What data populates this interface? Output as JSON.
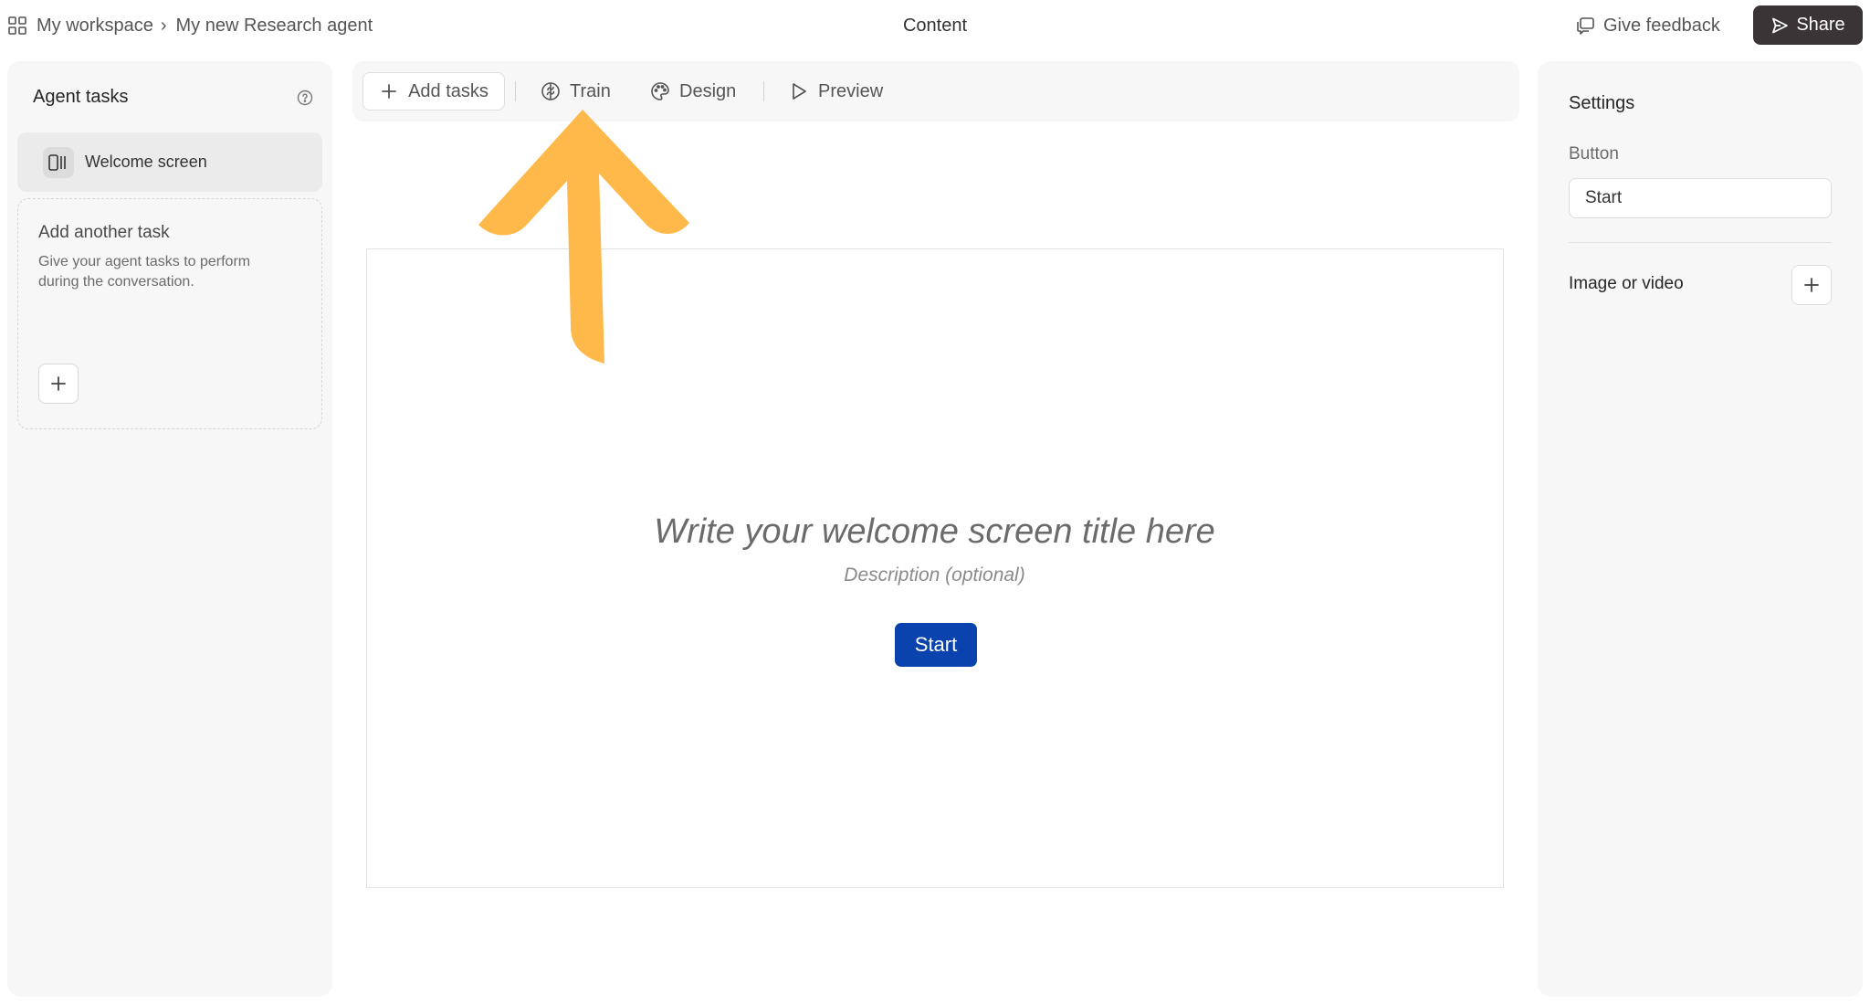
{
  "breadcrumb": {
    "workspace": "My workspace",
    "separator": "›",
    "agent": "My new Research agent"
  },
  "header": {
    "title": "Content",
    "feedback_label": "Give feedback",
    "share_label": "Share"
  },
  "sidebar": {
    "title": "Agent tasks",
    "items": [
      {
        "label": "Welcome screen",
        "icon": "welcome-screen-icon"
      }
    ],
    "add_task": {
      "heading": "Add another task",
      "description": "Give your agent tasks to perform during the conversation."
    }
  },
  "toolbar": {
    "add_tasks": "Add tasks",
    "train": "Train",
    "design": "Design",
    "preview": "Preview"
  },
  "canvas": {
    "title_placeholder": "Write your welcome screen title here",
    "description_placeholder": "Description (optional)",
    "button_label": "Start"
  },
  "settings": {
    "title": "Settings",
    "button_field_label": "Button",
    "button_field_value": "Start",
    "media_label": "Image or video"
  },
  "colors": {
    "share_bg": "#3b3437",
    "start_button": "#0a43ad",
    "annotation_arrow": "#ffb84a"
  }
}
